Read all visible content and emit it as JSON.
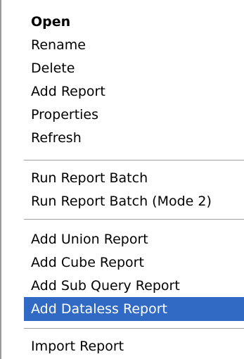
{
  "menu": {
    "groups": [
      {
        "items": [
          {
            "label": "Open",
            "default": true
          },
          {
            "label": "Rename"
          },
          {
            "label": "Delete"
          },
          {
            "label": "Add Report"
          },
          {
            "label": "Properties"
          },
          {
            "label": "Refresh"
          }
        ]
      },
      {
        "items": [
          {
            "label": "Run Report Batch"
          },
          {
            "label": "Run Report Batch (Mode 2)"
          }
        ]
      },
      {
        "items": [
          {
            "label": "Add Union Report"
          },
          {
            "label": "Add Cube Report"
          },
          {
            "label": "Add Sub Query Report"
          },
          {
            "label": "Add Dataless Report",
            "highlighted": true
          }
        ]
      },
      {
        "items": [
          {
            "label": "Import Report"
          }
        ]
      }
    ],
    "colors": {
      "highlight_bg": "#316ac5",
      "highlight_text": "#ffffff",
      "separator": "#a0a0a0"
    }
  }
}
